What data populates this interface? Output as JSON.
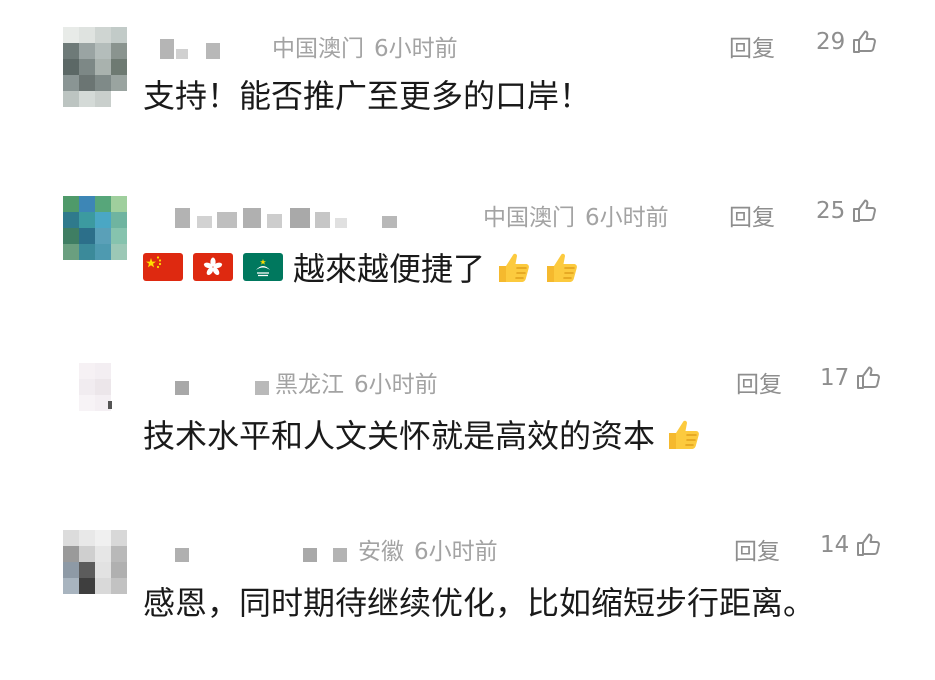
{
  "comments": [
    {
      "location": "中国澳门",
      "time": "6小时前",
      "reply_label": "回复",
      "likes": "29",
      "text": "支持！能否推广至更多的口岸！",
      "avatar_colors": [
        "#e8ebe8",
        "#dfe3e0",
        "#cfd5d2",
        "#c2cbc8",
        "#6e7a78",
        "#9aa4a3",
        "#b4bdbb",
        "#8a948f",
        "#5c6866",
        "#7d8886",
        "#a9b2ae",
        "#6e7a72",
        "#8a9594",
        "#6b7573",
        "#7f8a88",
        "#9aa4a0",
        "#bcc4c1",
        "#d4dad7",
        "#c9cfcc",
        "#ffffff"
      ]
    },
    {
      "location": "中国澳门",
      "time": "6小时前",
      "reply_label": "回复",
      "likes": "25",
      "text": "越來越便捷了",
      "flags": [
        "china-flag-icon",
        "hong-kong-flag-icon",
        "macau-flag-icon"
      ],
      "thumbs": 2,
      "avatar_colors": [
        "#4f9a6a",
        "#3d86b6",
        "#57a67a",
        "#9fcf9d",
        "#2f7a8c",
        "#3c9aa0",
        "#4aa7c4",
        "#6fb4a0",
        "#3f7e63",
        "#2c6f8a",
        "#5aa0b8",
        "#86c3ae",
        "#6a9f7f",
        "#3b8a9a",
        "#4e9ab0",
        "#9cc8b6",
        "#ffffff",
        "#ffffff",
        "#ffffff",
        "#ffffff"
      ]
    },
    {
      "location": "黑龙江",
      "time": "6小时前",
      "reply_label": "回复",
      "likes": "17",
      "text": "技术水平和人文关怀就是高效的资本",
      "thumbs": 1,
      "avatar_colors": [
        "#ffffff",
        "#f6f1f4",
        "#f3eef2",
        "#ffffff",
        "#ffffff",
        "#f1ecf0",
        "#ece6ea",
        "#ffffff",
        "#ffffff",
        "#f7f3f6",
        "#f4eff3",
        "#ffffff",
        "#ffffff",
        "#ffffff",
        "#ffffff",
        "#ffffff",
        "#ffffff",
        "#ffffff",
        "#ffffff",
        "#ffffff"
      ]
    },
    {
      "location": "安徽",
      "time": "6小时前",
      "reply_label": "回复",
      "likes": "14",
      "text": "感恩，同时期待继续优化，比如缩短步行距离。",
      "avatar_colors": [
        "#dcdcdc",
        "#e8e8e8",
        "#f0f0f0",
        "#d8d8d8",
        "#9a9a9a",
        "#cfcfcf",
        "#e6e6e6",
        "#b9b9b9",
        "#8e9aa6",
        "#5c5c5c",
        "#e2e2e2",
        "#b0b0b0",
        "#a8b4bf",
        "#3e3e3e",
        "#d9d9d9",
        "#c2c2c2",
        "#ffffff",
        "#ffffff",
        "#ffffff",
        "#ffffff"
      ]
    }
  ]
}
